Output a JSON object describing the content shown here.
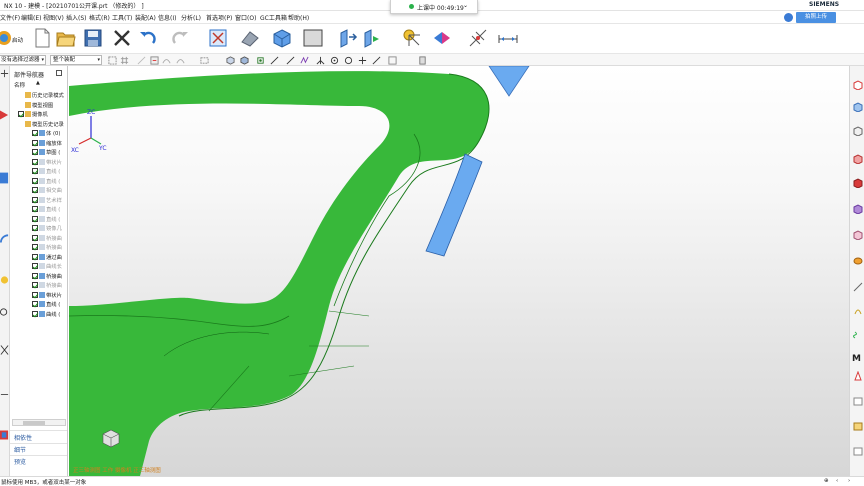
{
  "window": {
    "title": "NX 10 - 建模 - [20210701公开课.prt （修改的） ]",
    "brand": "SIEMENS"
  },
  "recording": {
    "text": "上课中 00:49:19"
  },
  "menubar": {
    "items": [
      "文件(F)",
      "编辑(E)",
      "视图(V)",
      "插入(S)",
      "格式(R)",
      "工具(T)",
      "装配(A)",
      "信息(I)",
      "分析(L)",
      "首选项(P)",
      "窗口(O)",
      "GC工具箱",
      "帮助(H)"
    ]
  },
  "upload": {
    "label": "拍照上传"
  },
  "toolbar": {
    "start_label": "启动"
  },
  "selection_bar": {
    "filter_value": "没有选择过滤器",
    "scope_value": "整个装配"
  },
  "navigator": {
    "title": "部件导航器",
    "column_name": "名称",
    "items": [
      {
        "label": "历史记录模式",
        "checked": false,
        "dim": false,
        "level": 0
      },
      {
        "label": "模型视图",
        "checked": false,
        "dim": false,
        "level": 0
      },
      {
        "label": "摄像机",
        "checked": true,
        "dim": false,
        "level": 0
      },
      {
        "label": "模型历史记录",
        "checked": false,
        "dim": false,
        "level": 0
      },
      {
        "label": "体 (0)",
        "checked": true,
        "dim": false,
        "level": 1
      },
      {
        "label": "缩放体",
        "checked": true,
        "dim": false,
        "level": 1
      },
      {
        "label": "草图 (",
        "checked": true,
        "dim": false,
        "level": 1
      },
      {
        "label": "带状片",
        "checked": true,
        "dim": true,
        "level": 1
      },
      {
        "label": "直线 (",
        "checked": true,
        "dim": true,
        "level": 1
      },
      {
        "label": "直线 (",
        "checked": true,
        "dim": true,
        "level": 1
      },
      {
        "label": "相交曲",
        "checked": true,
        "dim": true,
        "level": 1
      },
      {
        "label": "艺术样",
        "checked": true,
        "dim": true,
        "level": 1
      },
      {
        "label": "直线 (",
        "checked": true,
        "dim": true,
        "level": 1
      },
      {
        "label": "直线 (",
        "checked": true,
        "dim": true,
        "level": 1
      },
      {
        "label": "镜像几",
        "checked": true,
        "dim": true,
        "level": 1
      },
      {
        "label": "桥接曲",
        "checked": true,
        "dim": true,
        "level": 1
      },
      {
        "label": "桥接曲",
        "checked": true,
        "dim": true,
        "level": 1
      },
      {
        "label": "通过曲",
        "checked": true,
        "dim": false,
        "level": 1
      },
      {
        "label": "曲线长",
        "checked": true,
        "dim": true,
        "level": 1
      },
      {
        "label": "桥接曲",
        "checked": true,
        "dim": false,
        "level": 1
      },
      {
        "label": "桥接曲",
        "checked": true,
        "dim": true,
        "level": 1
      },
      {
        "label": "带状片",
        "checked": true,
        "dim": false,
        "level": 1
      },
      {
        "label": "直线 (",
        "checked": true,
        "dim": false,
        "level": 1
      },
      {
        "label": "曲线 (",
        "checked": true,
        "dim": false,
        "level": 1
      }
    ],
    "sections": [
      "相依性",
      "细节",
      "预览"
    ]
  },
  "viewport": {
    "axes": {
      "z": "ZC",
      "x": "XC",
      "y": "YC"
    },
    "status": "正三轴测图 工作 摄像机 正三轴测图"
  },
  "statusbar": {
    "message": "鼠标使用 MB3，或者双击某一对象"
  },
  "colors": {
    "model_green": "#3fbf3f",
    "model_dark": "#1f8a1f",
    "patch_blue": "#6aaaf0",
    "accent_blue": "#4a90e2"
  }
}
